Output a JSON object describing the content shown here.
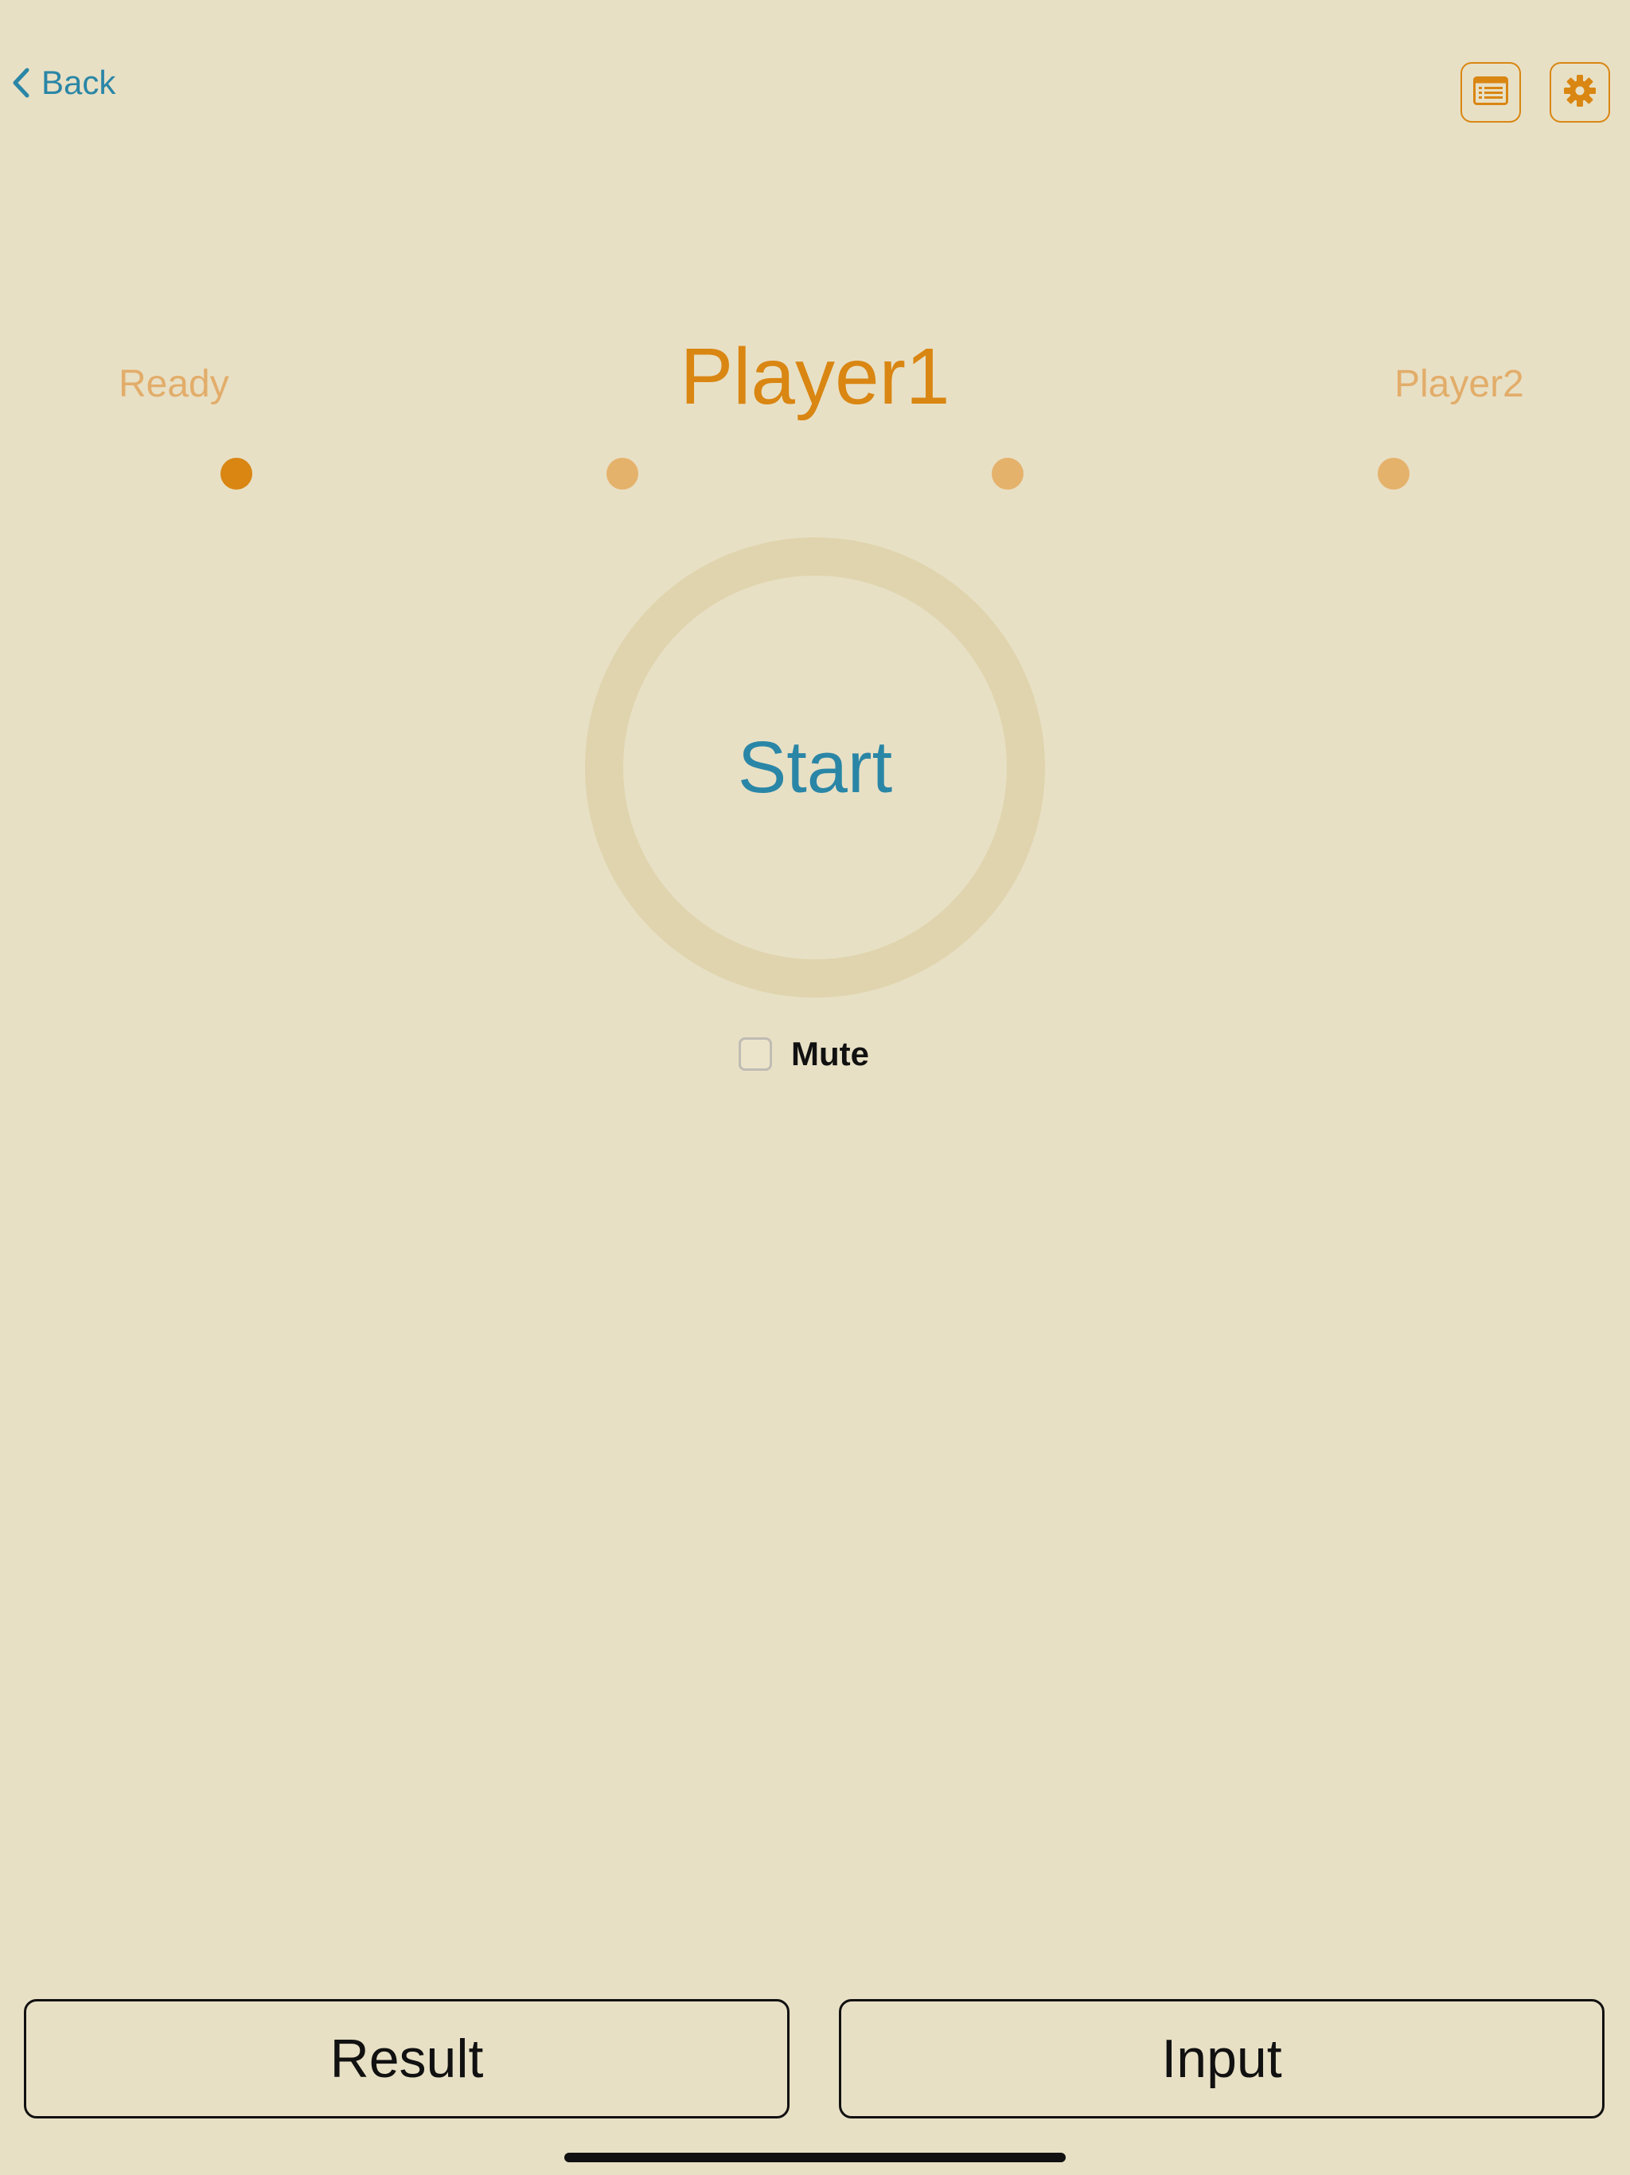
{
  "nav": {
    "back_label": "Back"
  },
  "toolbar": {
    "list_icon": "list-icon",
    "settings_icon": "gear-icon"
  },
  "steps": {
    "left_label": "Ready",
    "current_label": "Player1",
    "right_label": "Player2",
    "dot_count": 4,
    "active_dot_index": 0
  },
  "start": {
    "label": "Start"
  },
  "mute": {
    "label": "Mute",
    "checked": false
  },
  "buttons": {
    "result_label": "Result",
    "input_label": "Input"
  },
  "colors": {
    "background": "#e8e0c5",
    "accent_orange": "#d98612",
    "muted_orange": "#e2ad6a",
    "link_blue": "#2a86a6",
    "ring": "#dfd4ad"
  }
}
